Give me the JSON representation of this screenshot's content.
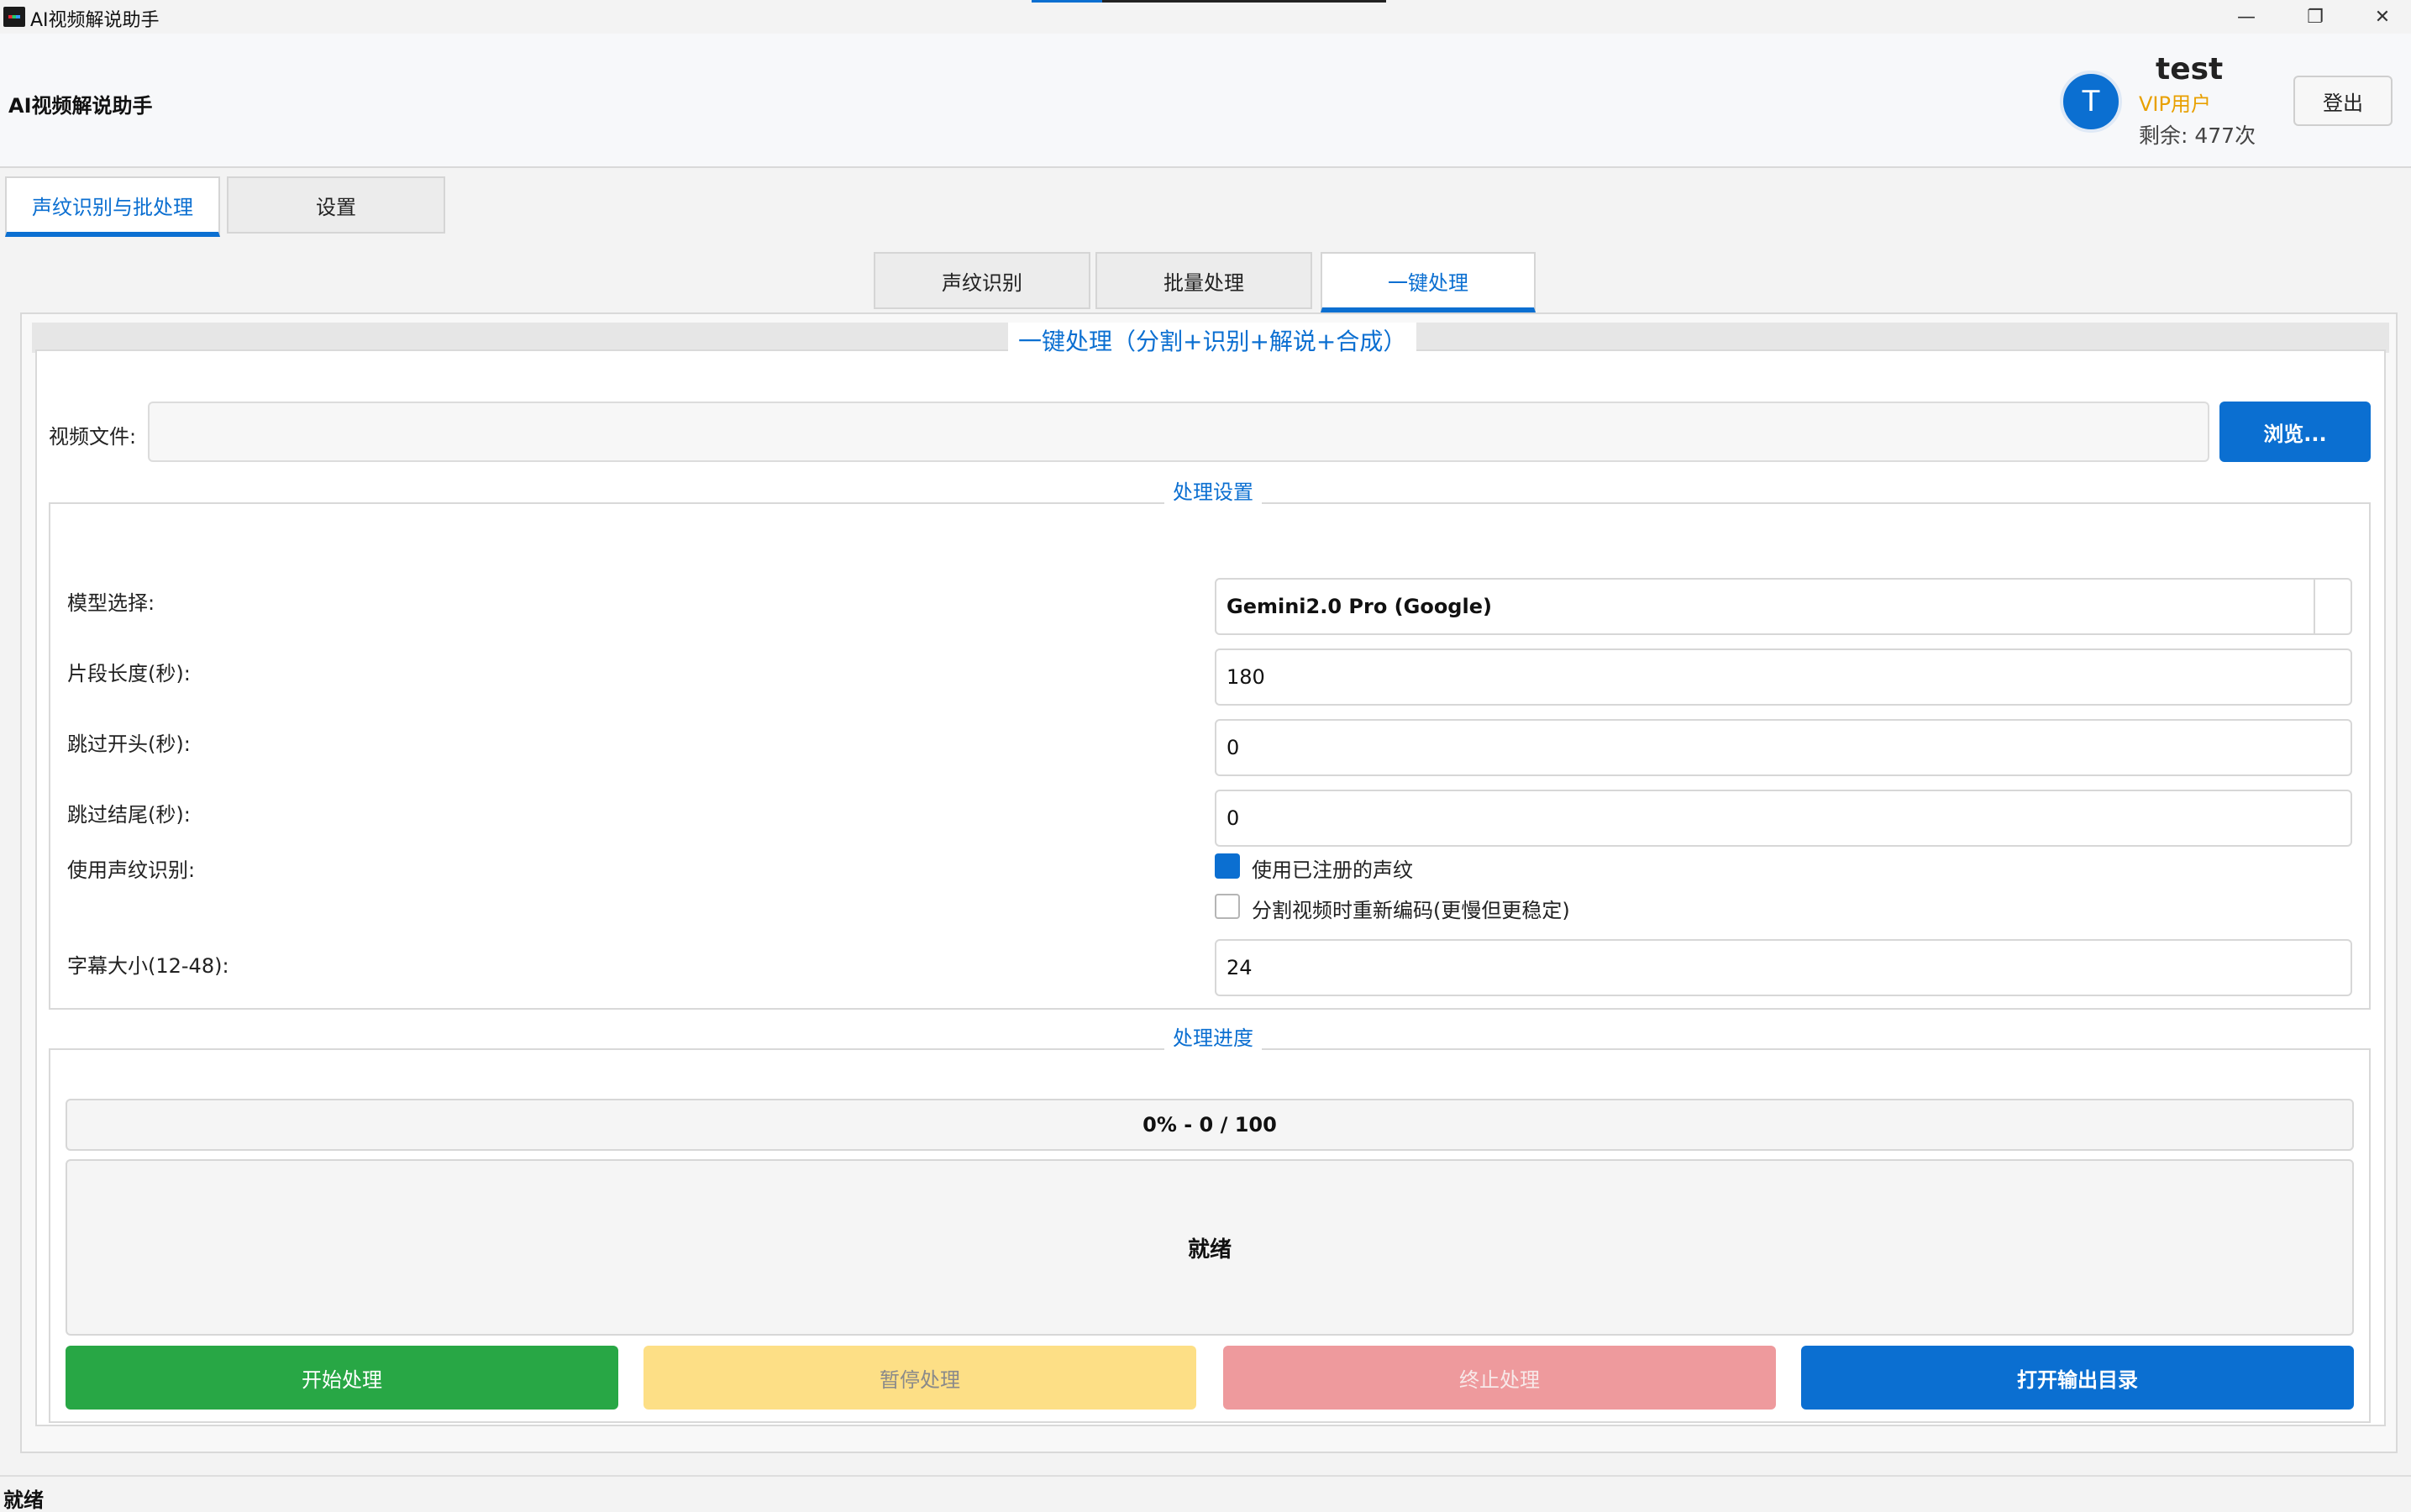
{
  "window": {
    "title": "AI视频解说助手",
    "controls": {
      "minimize": "—",
      "maximize": "❐",
      "close": "✕"
    }
  },
  "header": {
    "title": "AI视频解说助手",
    "avatar_letter": "T",
    "username": "test",
    "vip": "VIP用户",
    "remaining": "剩余: 477次",
    "logout": "登出"
  },
  "main_tabs": [
    {
      "label": "声纹识别与批处理",
      "active": true
    },
    {
      "label": "设置",
      "active": false
    }
  ],
  "sub_tabs": [
    {
      "label": "声纹识别",
      "active": false
    },
    {
      "label": "批量处理",
      "active": false
    },
    {
      "label": "一键处理",
      "active": true
    }
  ],
  "panel": {
    "title": "一键处理（分割+识别+解说+合成）",
    "video_label": "视频文件:",
    "video_value": "",
    "browse": "浏览..."
  },
  "settings": {
    "title": "处理设置",
    "model_label": "模型选择:",
    "model_value": "Gemini2.0 Pro (Google)",
    "segment_label": "片段长度(秒):",
    "segment_value": "180",
    "skip_start_label": "跳过开头(秒):",
    "skip_start_value": "0",
    "skip_end_label": "跳过结尾(秒):",
    "skip_end_value": "0",
    "voiceprint_label": "使用声纹识别:",
    "use_registered_label": "使用已注册的声纹",
    "use_registered_checked": true,
    "reencode_label": "分割视频时重新编码(更慢但更稳定)",
    "reencode_checked": false,
    "subtitle_label": "字幕大小(12-48):",
    "subtitle_value": "24"
  },
  "progress": {
    "title": "处理进度",
    "text": "0% - 0 / 100",
    "percent": 0,
    "current": 0,
    "total": 100,
    "log": "就绪"
  },
  "actions": {
    "start": "开始处理",
    "pause": "暂停处理",
    "stop": "终止处理",
    "open_output": "打开输出目录"
  },
  "status_bar": {
    "text": "就绪"
  },
  "colors": {
    "accent": "#0b6fd1",
    "start": "#28a745",
    "pause": "#fddf86",
    "stop": "#ee9a9d",
    "vip": "#e8a000"
  }
}
